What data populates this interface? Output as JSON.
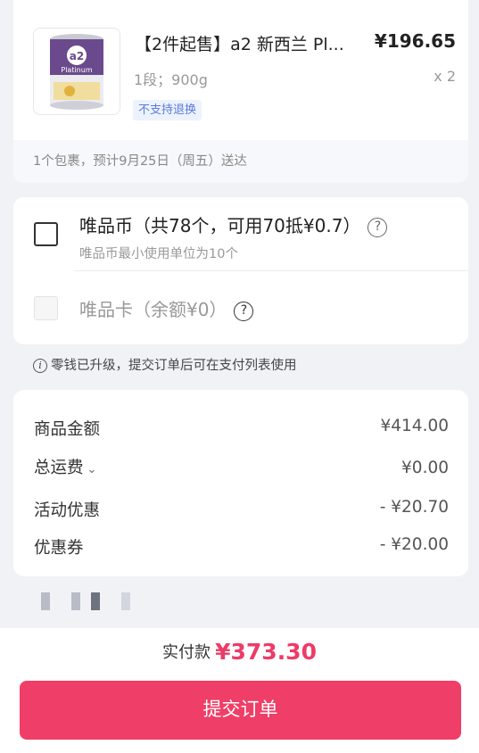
{
  "product": {
    "title": "【2件起售】a2 新西兰 Pl...",
    "price": "¥196.65",
    "spec": "1段；900g",
    "quantity": "x 2",
    "badge": "不支持退换",
    "image_brand": "a2",
    "image_line": "Platinum",
    "delivery": "1个包裹，预计9月25日（周五）送达"
  },
  "coins": {
    "label": "唯品币（共78个，可用70抵¥0.7）",
    "hint": "唯品币最小使用单位为10个",
    "checked": false
  },
  "card": {
    "label": "唯品卡（余额¥0）",
    "disabled": true
  },
  "change_note": "零钱已升级，提交订单后可在支付列表使用",
  "summary": [
    {
      "label": "商品金额",
      "value": "¥414.00"
    },
    {
      "label": "总运费",
      "value": "¥0.00",
      "expandable": true
    },
    {
      "label": "活动优惠",
      "value": "- ¥20.70"
    },
    {
      "label": "优惠券",
      "value": "- ¥20.00"
    }
  ],
  "footer": {
    "total_label": "实付款",
    "total_amount": "¥373.30",
    "submit_label": "提交订单"
  },
  "colors": {
    "accent": "#ef3e67",
    "badge_bg": "#edf2ff",
    "badge_text": "#5c7bd6",
    "background": "#f1f2f6"
  },
  "icons": [
    "help-icon",
    "info-icon",
    "chevron-down-icon"
  ]
}
